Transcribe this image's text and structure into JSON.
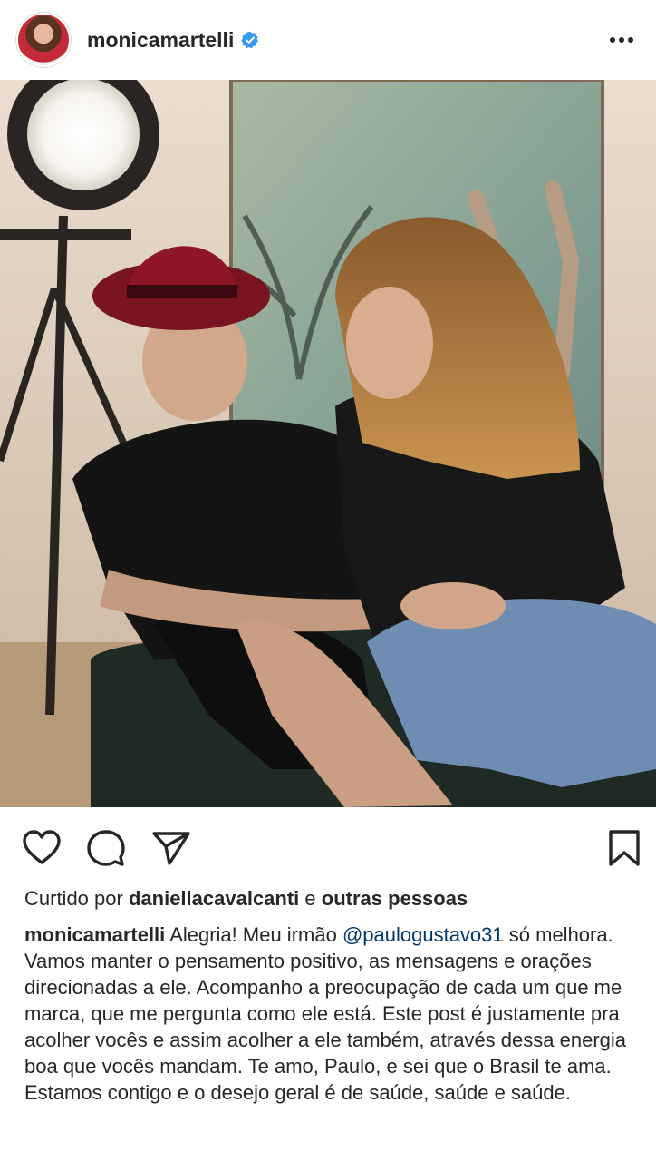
{
  "header": {
    "username": "monicamartelli",
    "verified": true,
    "more_icon": "more-horizontal-icon"
  },
  "photo": {
    "alt": "Photo post"
  },
  "actions": {
    "like_icon": "heart-icon",
    "comment_icon": "comment-icon",
    "share_icon": "send-icon",
    "save_icon": "bookmark-icon"
  },
  "likes": {
    "prefix": "Curtido por",
    "user": "daniellacavalcanti",
    "connector": "e",
    "others": "outras pessoas"
  },
  "caption": {
    "username": "monicamartelli",
    "text_before": "Alegria! Meu irmão",
    "mention": "@paulogustavo31",
    "text_after": "só melhora. Vamos manter o pensamento positivo, as mensagens e orações direcionadas a ele. Acompanho a preocupação de cada um que me marca, que me pergunta como ele está. Este post é justamente pra acolher vocês e assim acolher a ele também, através dessa energia boa que vocês mandam. Te amo, Paulo, e sei que o Brasil te ama. Estamos contigo e o desejo geral é de saúde, saúde e saúde."
  },
  "colors": {
    "text": "#262626",
    "mention": "#00376b",
    "verified": "#3897f0"
  }
}
